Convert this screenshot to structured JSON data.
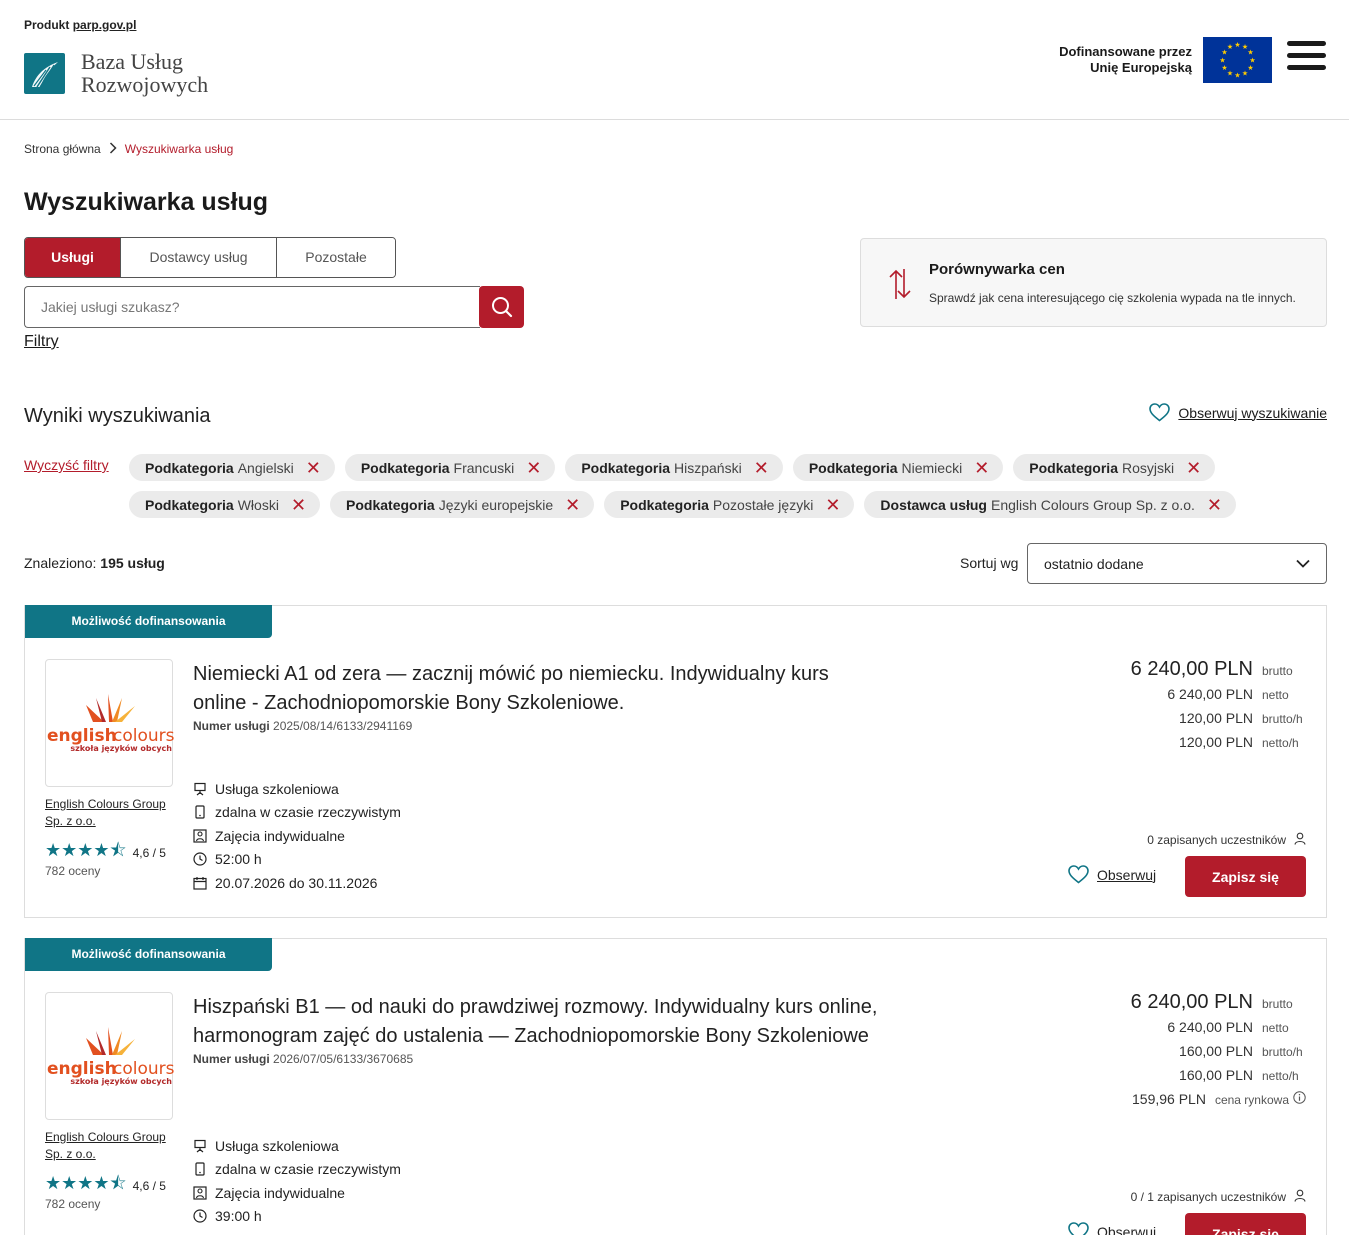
{
  "header": {
    "product_prefix": "Produkt",
    "product_link": "parp.gov.pl",
    "logo_line1": "Baza Usług",
    "logo_line2": "Rozwojowych",
    "eu_line1": "Dofinansowane przez",
    "eu_line2": "Unię Europejską"
  },
  "breadcrumb": {
    "home": "Strona główna",
    "current": "Wyszukiwarka usług"
  },
  "page_title": "Wyszukiwarka usług",
  "tabs": [
    {
      "label": "Usługi",
      "active": true
    },
    {
      "label": "Dostawcy usług",
      "active": false
    },
    {
      "label": "Pozostałe",
      "active": false
    }
  ],
  "search": {
    "placeholder": "Jakiej usługi szukasz?",
    "value": ""
  },
  "filters_link": "Filtry",
  "compare": {
    "title": "Porównywarka cen",
    "description": "Sprawdź jak cena interesującego cię szkolenia wypada na tle innych."
  },
  "results": {
    "title": "Wyniki wyszukiwania",
    "observe_search": "Obserwuj wyszukiwanie",
    "clear_filters": "Wyczyść filtry",
    "chips": [
      {
        "key": "Podkategoria",
        "value": "Angielski"
      },
      {
        "key": "Podkategoria",
        "value": "Francuski"
      },
      {
        "key": "Podkategoria",
        "value": "Hiszpański"
      },
      {
        "key": "Podkategoria",
        "value": "Niemiecki"
      },
      {
        "key": "Podkategoria",
        "value": "Rosyjski"
      },
      {
        "key": "Podkategoria",
        "value": "Włoski"
      },
      {
        "key": "Podkategoria",
        "value": "Języki europejskie"
      },
      {
        "key": "Podkategoria",
        "value": "Pozostałe języki"
      },
      {
        "key": "Dostawca usług",
        "value": "English Colours Group Sp. z o.o."
      }
    ],
    "found_prefix": "Znaleziono:",
    "found_count": "195 usług",
    "sort_label": "Sortuj wg",
    "sort_value": "ostatnio dodane"
  },
  "cards": [
    {
      "badge": "Możliwość dofinansowania",
      "logo_word1": "english",
      "logo_word2": "colours",
      "logo_sub": "szkoła języków obcych",
      "provider_line1": "English Colours Group",
      "provider_line2": "Sp. z o.o.",
      "rating": "4,6 / 5",
      "rating_count": "782 oceny",
      "title_line1": "Niemiecki A1 od zera — zacznij mówić po niemiecku. Indywidualny kurs",
      "title_line2": "online - Zachodniopomorskie Bony Szkoleniowe.",
      "service_no_label": "Numer usługi",
      "service_no": "2025/08/14/6133/2941169",
      "features": [
        "Usługa szkoleniowa",
        "zdalna w czasie rzeczywistym",
        "Zajęcia indywidualne",
        "52:00 h",
        "20.07.2026 do 30.11.2026"
      ],
      "prices": [
        {
          "val": "6 240,00 PLN",
          "lbl": "brutto"
        },
        {
          "val": "6 240,00 PLN",
          "lbl": "netto"
        },
        {
          "val": "120,00 PLN",
          "lbl": "brutto/h"
        },
        {
          "val": "120,00 PLN",
          "lbl": "netto/h"
        }
      ],
      "enrolled": "0 zapisanych uczestników",
      "observe": "Obserwuj",
      "signup": "Zapisz się"
    },
    {
      "badge": "Możliwość dofinansowania",
      "logo_word1": "english",
      "logo_word2": "colours",
      "logo_sub": "szkoła języków obcych",
      "provider_line1": "English Colours Group",
      "provider_line2": "Sp. z o.o.",
      "rating": "4,6 / 5",
      "rating_count": "782 oceny",
      "title_line1": "Hiszpański B1 — od nauki do prawdziwej rozmowy. Indywidualny kurs online,",
      "title_line2": "harmonogram zajęć do ustalenia — Zachodniopomorskie Bony Szkoleniowe",
      "service_no_label": "Numer usługi",
      "service_no": "2026/07/05/6133/3670685",
      "features": [
        "Usługa szkoleniowa",
        "zdalna w czasie rzeczywistym",
        "Zajęcia indywidualne",
        "39:00 h"
      ],
      "prices": [
        {
          "val": "6 240,00 PLN",
          "lbl": "brutto"
        },
        {
          "val": "6 240,00 PLN",
          "lbl": "netto"
        },
        {
          "val": "160,00 PLN",
          "lbl": "brutto/h"
        },
        {
          "val": "160,00 PLN",
          "lbl": "netto/h"
        },
        {
          "val": "159,96 PLN",
          "lbl": "cena rynkowa"
        }
      ],
      "enrolled": "0 / 1 zapisanych uczestników",
      "observe": "Obserwuj",
      "signup": "Zapisz się"
    }
  ]
}
